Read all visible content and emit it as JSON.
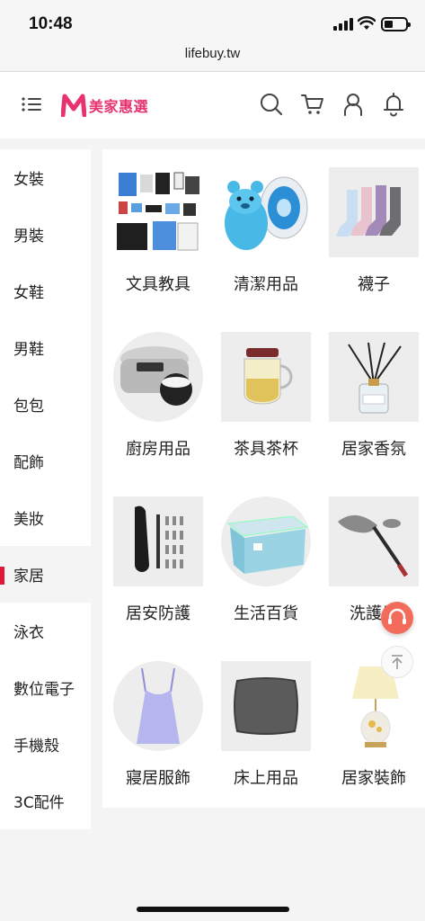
{
  "status_bar": {
    "time": "10:48"
  },
  "browser": {
    "url": "lifebuy.tw"
  },
  "header": {
    "logo_text": "美家惠選",
    "colors": {
      "brand": "#e8336e",
      "accent_red": "#e0193a"
    }
  },
  "sidebar": {
    "active_index": 7,
    "items": [
      {
        "label": "女裝"
      },
      {
        "label": "男裝"
      },
      {
        "label": "女鞋"
      },
      {
        "label": "男鞋"
      },
      {
        "label": "包包"
      },
      {
        "label": "配飾"
      },
      {
        "label": "美妝"
      },
      {
        "label": "家居"
      },
      {
        "label": "泳衣"
      },
      {
        "label": "數位電子"
      },
      {
        "label": "手機殼"
      },
      {
        "label": "3C配件"
      }
    ]
  },
  "grid": {
    "items": [
      {
        "label": "文具教具",
        "icon": "stationery-icon"
      },
      {
        "label": "清潔用品",
        "icon": "toilet-cleaner-icon"
      },
      {
        "label": "襪子",
        "icon": "socks-icon"
      },
      {
        "label": "廚房用品",
        "icon": "rice-cooker-icon"
      },
      {
        "label": "茶具茶杯",
        "icon": "teapot-icon"
      },
      {
        "label": "居家香氛",
        "icon": "reed-diffuser-icon"
      },
      {
        "label": "居安防護",
        "icon": "screwdriver-set-icon"
      },
      {
        "label": "生活百貨",
        "icon": "storage-box-icon"
      },
      {
        "label": "洗護日",
        "icon": "duster-icon"
      },
      {
        "label": "寢居服飾",
        "icon": "camisole-icon"
      },
      {
        "label": "床上用品",
        "icon": "pillow-icon"
      },
      {
        "label": "居家裝飾",
        "icon": "table-lamp-icon"
      }
    ]
  }
}
